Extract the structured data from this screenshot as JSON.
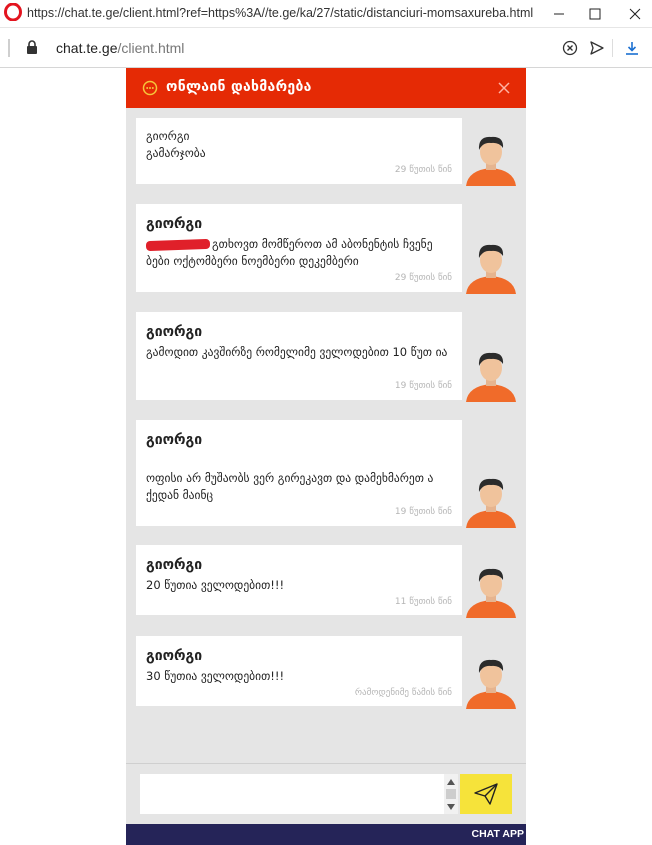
{
  "window": {
    "title_url": "https://chat.te.ge/client.html?ref=https%3A//te.ge/ka/27/static/distanciuri-momsaxureba.html&",
    "minimize_icon": "minimize-icon",
    "maximize_icon": "maximize-icon",
    "close_icon": "close-icon"
  },
  "address_bar": {
    "domain": "chat.te.ge",
    "path": "/client.html",
    "icons": [
      "lock-icon",
      "clear-icon",
      "send-icon",
      "download-icon"
    ]
  },
  "chat": {
    "header_title": "ონლაინ დახმარება",
    "header_color": "#e52a05",
    "messages": [
      {
        "author": "",
        "lines": [
          "გიორგი",
          "გამარჯობა"
        ],
        "time": "29 წუთის წინ"
      },
      {
        "author": "გიორგი",
        "redacted_prefix": true,
        "text": "გთხოვთ მომწეროთ ამ აბონენტის ჩვენე ბები ოქტომბერი ნოემბერი დეკემბერი",
        "time": "29 წუთის წინ"
      },
      {
        "author": "გიორგი",
        "text": "გამოდით კავშირზე რომელიმე ველოდებით 10 წუთ ია",
        "time": "19 წუთის წინ"
      },
      {
        "author": "გიორგი",
        "text": "ოფისი არ მუშაობს ვერ გირეკავთ და დამეხმარეთ ა ქედან მაინც",
        "time": "19 წუთის წინ"
      },
      {
        "author": "გიორგი",
        "text": "20 წუთია ველოდებით!!!",
        "time": "11 წუთის წინ"
      },
      {
        "author": "გიორგი",
        "text": "30 წუთია ველოდებით!!!",
        "time": "რამოდენიმე წამის წინ"
      }
    ],
    "input": {
      "value": "",
      "placeholder": ""
    },
    "send_icon": "paper-plane-icon",
    "send_color": "#f6e33a",
    "footer_label": "CHAT APP",
    "footer_color": "#252458"
  }
}
